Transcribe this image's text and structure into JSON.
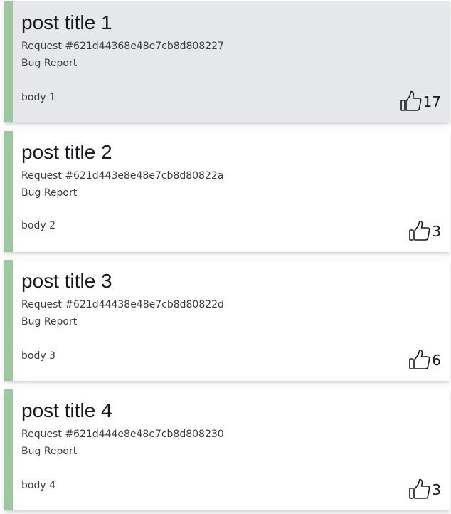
{
  "posts": [
    {
      "title": "post title 1",
      "request": "Request #621d44368e48e7cb8d808227",
      "category": "Bug Report",
      "body": "body 1",
      "upvotes": "17",
      "hovered": true
    },
    {
      "title": "post title 2",
      "request": "Request #621d443e8e48e7cb8d80822a",
      "category": "Bug Report",
      "body": "body 2",
      "upvotes": "3",
      "hovered": false
    },
    {
      "title": "post title 3",
      "request": "Request #621d44438e48e7cb8d80822d",
      "category": "Bug Report",
      "body": "body 3",
      "upvotes": "6",
      "hovered": false
    },
    {
      "title": "post title 4",
      "request": "Request #621d444e8e48e7cb8d808230",
      "category": "Bug Report",
      "body": "body 4",
      "upvotes": "3",
      "hovered": false
    }
  ],
  "colors": {
    "accent_border": "#9dc7a1",
    "hover_background": "#e6e7eb",
    "card_background": "#ffffff"
  },
  "icons": {
    "upvote": "thumbs-up-icon"
  }
}
